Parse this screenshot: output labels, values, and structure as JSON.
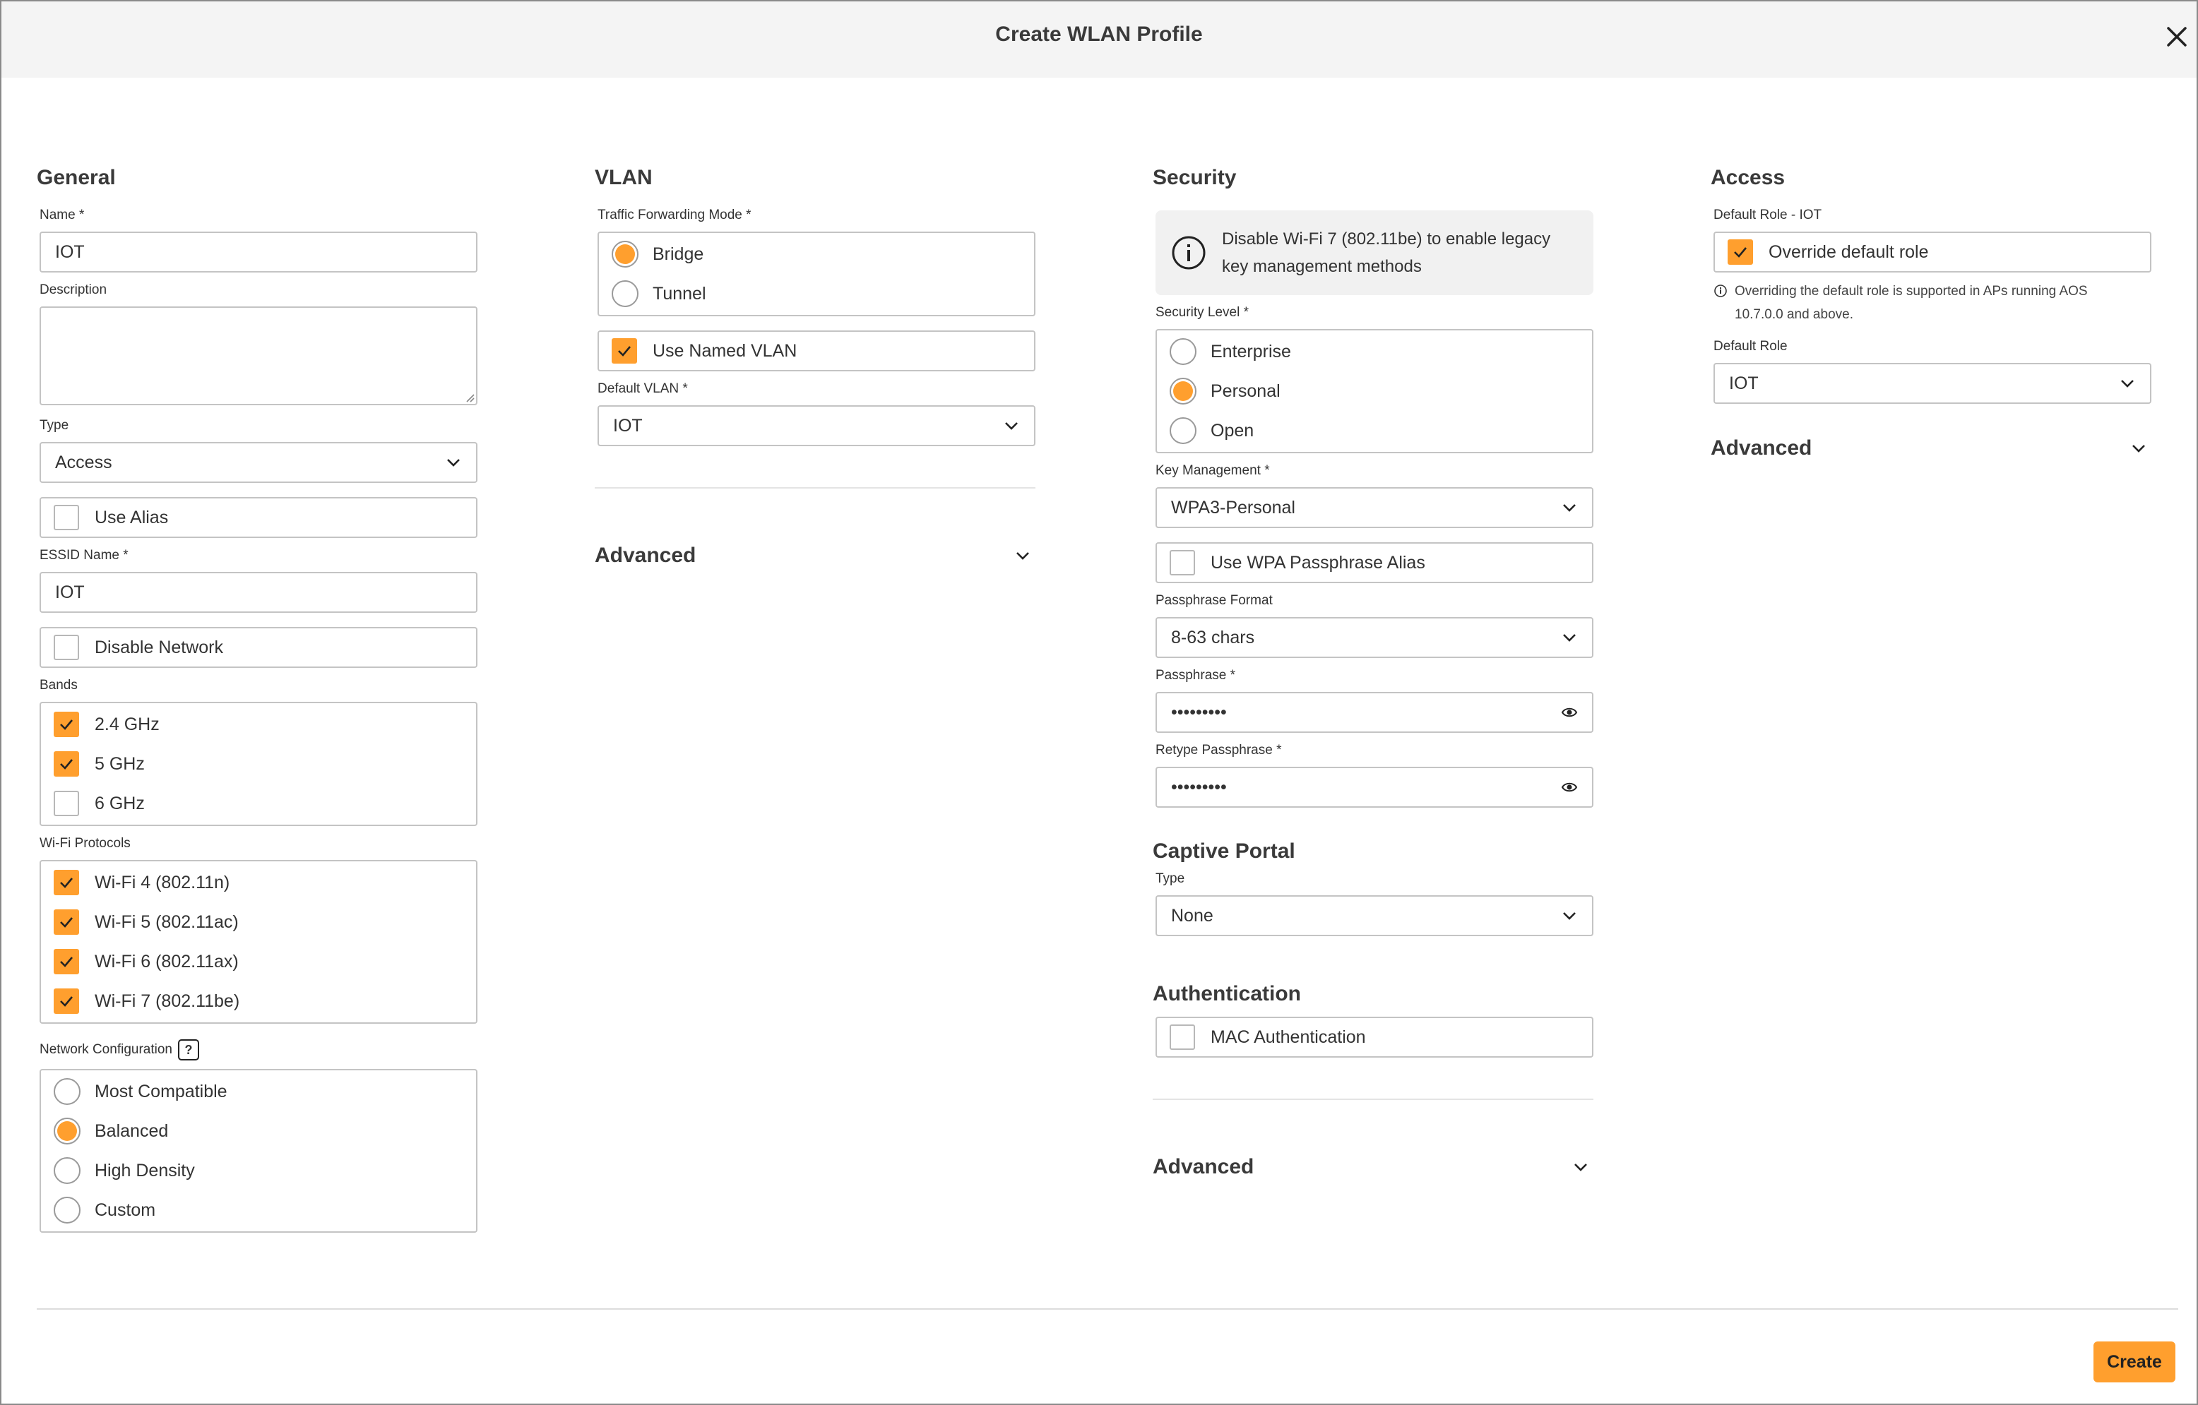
{
  "dialog": {
    "title": "Create WLAN Profile",
    "create_label": "Create"
  },
  "colors": {
    "accent": "#ff9f2e",
    "border": "#c4c4c4",
    "header_bg": "#f4f4f4"
  },
  "general": {
    "heading": "General",
    "name_label": "Name *",
    "name_value": "IOT",
    "description_label": "Description",
    "description_value": "",
    "type_label": "Type",
    "type_value": "Access",
    "use_alias_label": "Use Alias",
    "use_alias_checked": false,
    "essid_label": "ESSID Name *",
    "essid_value": "IOT",
    "disable_network_label": "Disable Network",
    "disable_network_checked": false,
    "bands_label": "Bands",
    "bands": [
      {
        "label": "2.4 GHz",
        "checked": true
      },
      {
        "label": "5 GHz",
        "checked": true
      },
      {
        "label": "6 GHz",
        "checked": false
      }
    ],
    "protocols_label": "Wi-Fi Protocols",
    "protocols": [
      {
        "label": "Wi-Fi 4 (802.11n)",
        "checked": true
      },
      {
        "label": "Wi-Fi 5 (802.11ac)",
        "checked": true
      },
      {
        "label": "Wi-Fi 6 (802.11ax)",
        "checked": true
      },
      {
        "label": "Wi-Fi 7 (802.11be)",
        "checked": true
      }
    ],
    "netconfig_label": "Network Configuration",
    "netconfig_help": "?",
    "netconfig": [
      {
        "label": "Most Compatible",
        "selected": false
      },
      {
        "label": "Balanced",
        "selected": true
      },
      {
        "label": "High Density",
        "selected": false
      },
      {
        "label": "Custom",
        "selected": false
      }
    ]
  },
  "vlan": {
    "heading": "VLAN",
    "mode_label": "Traffic Forwarding Mode *",
    "modes": [
      {
        "label": "Bridge",
        "selected": true
      },
      {
        "label": "Tunnel",
        "selected": false
      }
    ],
    "named_vlan_label": "Use Named VLAN",
    "named_vlan_checked": true,
    "default_vlan_label": "Default VLAN *",
    "default_vlan_value": "IOT",
    "advanced_label": "Advanced"
  },
  "security": {
    "heading": "Security",
    "info_line1": "Disable Wi-Fi 7 (802.11be) to enable legacy",
    "info_line2": "key management methods",
    "level_label": "Security Level *",
    "levels": [
      {
        "label": "Enterprise",
        "selected": false
      },
      {
        "label": "Personal",
        "selected": true
      },
      {
        "label": "Open",
        "selected": false
      }
    ],
    "key_mgmt_label": "Key Management *",
    "key_mgmt_value": "WPA3-Personal",
    "wpa_alias_label": "Use WPA Passphrase Alias",
    "wpa_alias_checked": false,
    "passphrase_format_label": "Passphrase Format",
    "passphrase_format_value": "8-63 chars",
    "passphrase_label": "Passphrase *",
    "passphrase_value": "•••••••••",
    "retype_label": "Retype Passphrase *",
    "retype_value": "•••••••••",
    "captive_heading": "Captive Portal",
    "captive_type_label": "Type",
    "captive_type_value": "None",
    "auth_heading": "Authentication",
    "mac_auth_label": "MAC Authentication",
    "mac_auth_checked": false,
    "advanced_label": "Advanced"
  },
  "access": {
    "heading": "Access",
    "role_iot_label": "Default Role - IOT",
    "override_label": "Override default role",
    "override_checked": true,
    "note_line1": "Overriding the default role is supported in APs running AOS",
    "note_line2": "10.7.0.0 and above.",
    "default_role_label": "Default Role",
    "default_role_value": "IOT",
    "advanced_label": "Advanced"
  }
}
